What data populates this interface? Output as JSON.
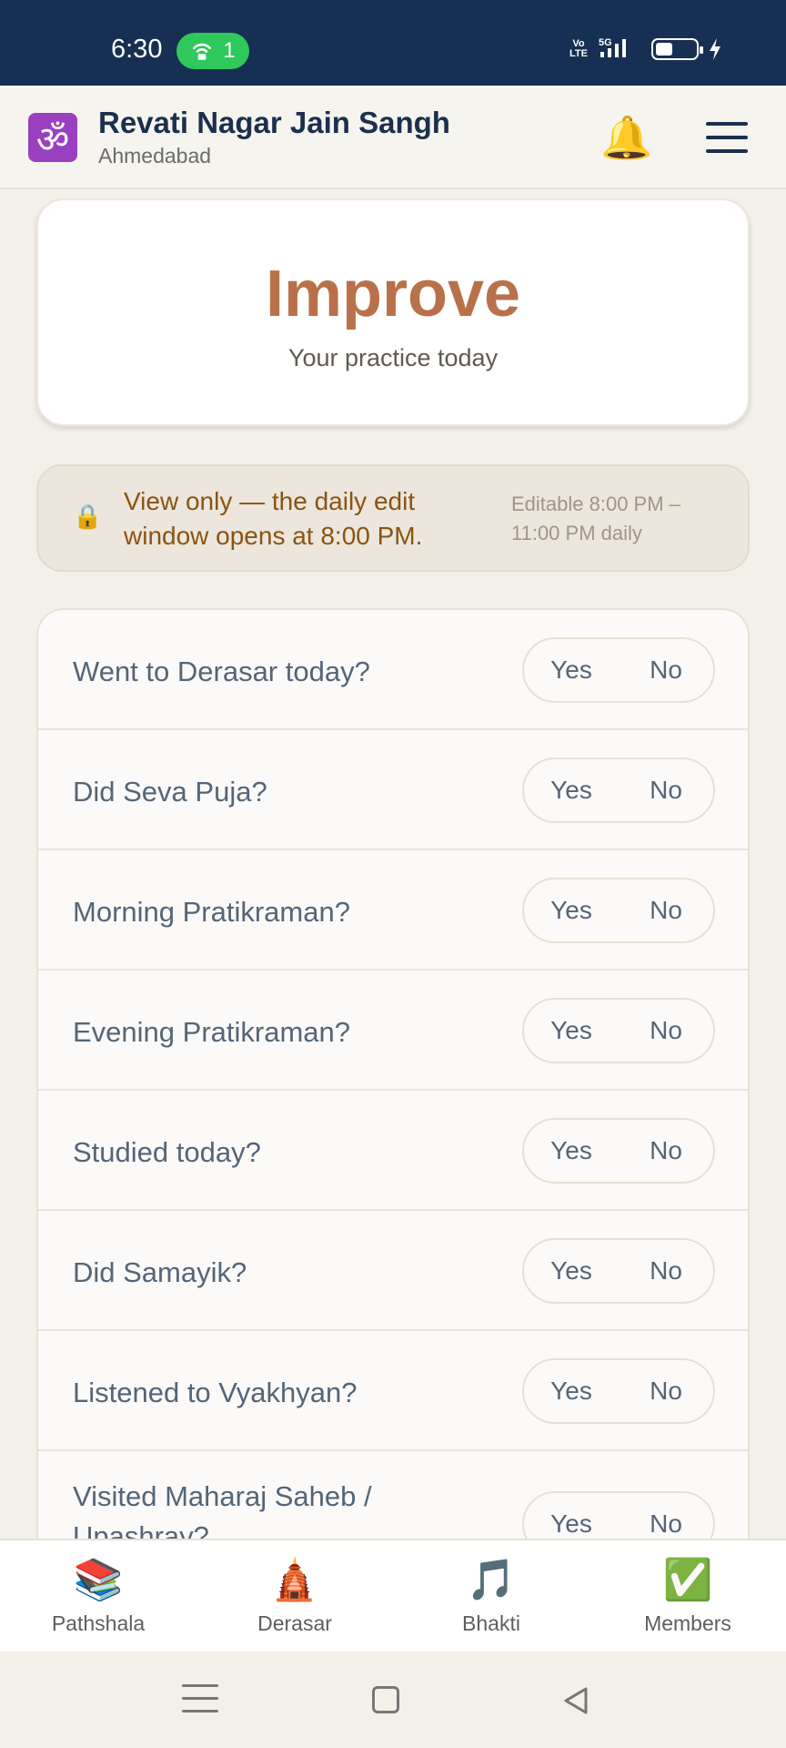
{
  "status_bar": {
    "time": "6:30",
    "hotspot_count": "1",
    "network": "5G"
  },
  "header": {
    "logo_glyph": "ॐ",
    "title": "Revati Nagar Jain Sangh",
    "subtitle": "Ahmedabad",
    "bell_icon": "bell-icon",
    "menu_icon": "hamburger-menu-icon"
  },
  "hero": {
    "title": "Improve",
    "subtitle": "Your practice today"
  },
  "notice": {
    "lock_glyph": "🔒",
    "message": "View only — the daily edit window opens at 8:00 PM.",
    "hint": "Editable 8:00 PM – 11:00 PM daily"
  },
  "questions": [
    {
      "label": "Went to Derasar today?",
      "yes": "Yes",
      "no": "No"
    },
    {
      "label": "Did Seva Puja?",
      "yes": "Yes",
      "no": "No"
    },
    {
      "label": "Morning Pratikraman?",
      "yes": "Yes",
      "no": "No"
    },
    {
      "label": "Evening Pratikraman?",
      "yes": "Yes",
      "no": "No"
    },
    {
      "label": "Studied today?",
      "yes": "Yes",
      "no": "No"
    },
    {
      "label": "Did Samayik?",
      "yes": "Yes",
      "no": "No"
    },
    {
      "label": "Listened to Vyakhyan?",
      "yes": "Yes",
      "no": "No"
    },
    {
      "label": "Visited Maharaj Saheb / Upashray?",
      "yes": "Yes",
      "no": "No"
    }
  ],
  "bottom_nav": [
    {
      "icon": "📚",
      "label": "Pathshala"
    },
    {
      "icon": "🛕",
      "label": "Derasar"
    },
    {
      "icon": "🎵",
      "label": "Bhakti"
    },
    {
      "icon": "✅",
      "label": "Members"
    }
  ],
  "colors": {
    "status_bar": "#172f52",
    "accent": "#b8714a",
    "notice_text": "#8a5413"
  }
}
